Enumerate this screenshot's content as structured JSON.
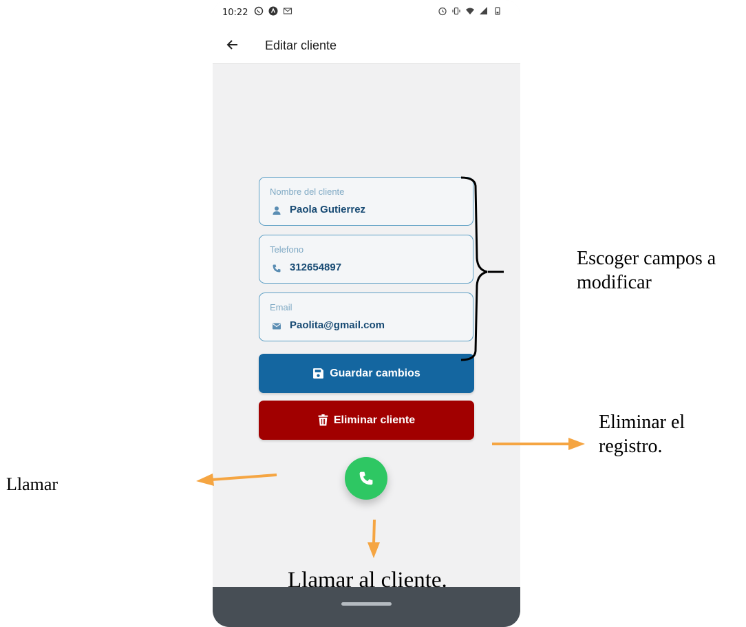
{
  "status_bar": {
    "time": "10:22",
    "left_icons": [
      "whatsapp-icon",
      "notification-icon",
      "mail-icon"
    ],
    "right_icons": [
      "alarm-icon",
      "vibrate-icon",
      "wifi-icon",
      "signal-icon",
      "battery-icon"
    ]
  },
  "appbar": {
    "title": "Editar cliente"
  },
  "form": {
    "name": {
      "label": "Nombre del cliente",
      "value": "Paola Gutierrez",
      "icon": "person-icon"
    },
    "phone": {
      "label": "Telefono",
      "value": "312654897",
      "icon": "phone-icon"
    },
    "email": {
      "label": "Email",
      "value": "Paolita@gmail.com",
      "icon": "mail-icon"
    }
  },
  "buttons": {
    "save_label": "Guardar cambios",
    "delete_label": "Eliminar cliente"
  },
  "annotations": {
    "campos": "Escoger campos a modificar",
    "eliminar": "Eliminar el registro.",
    "llamar": "Llamar",
    "llamar_cliente": "Llamar al cliente."
  },
  "colors": {
    "save_button": "#1466a0",
    "delete_button": "#a10000",
    "call_fab": "#2ec763",
    "field_border": "#5b9ec4",
    "field_value": "#174a73",
    "arrow": "#f5a542",
    "navbar": "#474e55"
  }
}
